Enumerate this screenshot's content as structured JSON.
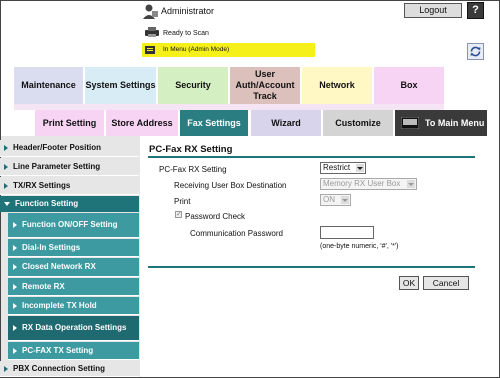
{
  "header": {
    "user_label": "Administrator",
    "logout_label": "Logout",
    "help_label": "?",
    "status_text": "Ready to Scan",
    "mode_text": "In Menu (Admin Mode)"
  },
  "tabs": {
    "maintenance": "Maintenance",
    "system_settings": "System Settings",
    "security": "Security",
    "user_auth": "User Auth/Account Track",
    "network": "Network",
    "box": "Box"
  },
  "sub_tabs": {
    "print_setting": "Print Setting",
    "store_address": "Store Address",
    "fax_settings": "Fax Settings",
    "wizard": "Wizard",
    "customize": "Customize",
    "to_main_menu": "To Main Menu"
  },
  "nav": {
    "header_footer": "Header/Footer Position",
    "line_parameter": "Line Parameter Setting",
    "tx_rx": "TX/RX Settings",
    "function_setting": "Function Setting",
    "function_onoff": "Function ON/OFF Setting",
    "dial_in": "Dial-In Settings",
    "closed_network": "Closed Network RX",
    "remote_rx": "Remote RX",
    "incomplete_tx": "Incomplete TX Hold",
    "rx_data_op": "RX Data Operation Settings",
    "pc_fax_tx": "PC-FAX TX Setting",
    "pbx_connection": "PBX Connection Setting"
  },
  "content": {
    "title": "PC-Fax RX Setting",
    "pcfax_label": "PC-Fax RX Setting",
    "pcfax_value": "Restrict",
    "receiving_box_label": "Receiving User Box Destination",
    "receiving_box_value": "Memory RX User Box",
    "print_label": "Print",
    "print_value": "ON",
    "password_check_label": "Password Check",
    "comm_password_label": "Communication Password",
    "comm_password_hint": "(one-byte numeric, '#', '*')",
    "ok_label": "OK",
    "cancel_label": "Cancel"
  },
  "colors": {
    "accent_teal": "#1e7478",
    "mode_bar_yellow": "#f6f01a"
  },
  "icons": [
    "administrator-icon",
    "printer-icon",
    "menu-mode-icon",
    "refresh-icon",
    "help-icon"
  ]
}
